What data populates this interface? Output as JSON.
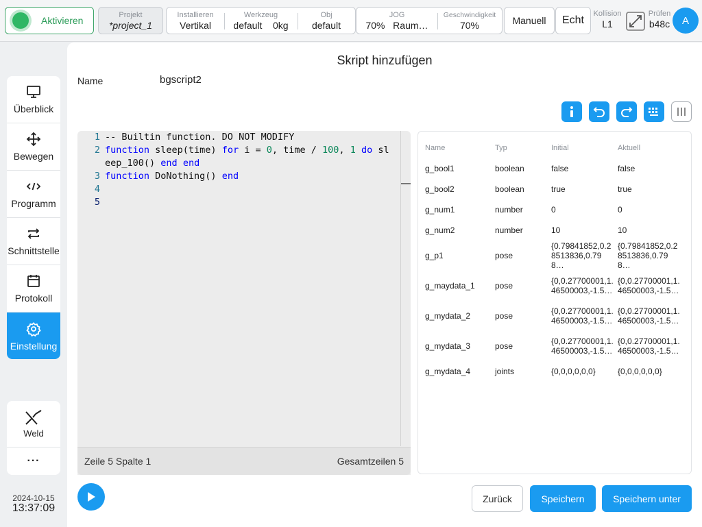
{
  "topbar": {
    "activate_label": "Aktivieren",
    "project_caption": "Projekt",
    "project_value": "*project_1",
    "install_caption": "Installieren",
    "install_value": "Vertikal",
    "tool_caption": "Werkzeug",
    "tool_value": "default",
    "tool_load": "0kg",
    "obj_caption": "Obj",
    "obj_value": "default",
    "jog_caption": "JOG",
    "jog_value": "70%",
    "jog_space": "Raum…",
    "speed_caption": "Geschwindigkeit",
    "speed_value": "70%",
    "manual_label": "Manuell",
    "real_label": "Echt",
    "collision_caption": "Kollision",
    "collision_value": "L1",
    "check_caption": "Prüfen",
    "check_value": "b48c",
    "avatar_letter": "A"
  },
  "sidebar": {
    "items": [
      {
        "label": "Überblick",
        "icon": "monitor-icon"
      },
      {
        "label": "Bewegen",
        "icon": "move-arrows-icon"
      },
      {
        "label": "Programm",
        "icon": "code-icon"
      },
      {
        "label": "Schnittstelle",
        "icon": "swap-icon"
      },
      {
        "label": "Protokoll",
        "icon": "calendar-icon"
      },
      {
        "label": "Einstellung",
        "icon": "gear-icon"
      }
    ],
    "active": "Einstellung",
    "weld_label": "Weld",
    "more_label": "···",
    "date": "2024-10-15",
    "time": "13:37:09"
  },
  "dialog": {
    "title": "Skript hinzufügen",
    "name_label": "Name",
    "name_value": "bgscript2"
  },
  "editor": {
    "lines": [
      {
        "num": "1",
        "text": "-- Builtin function. DO NOT MODIFY"
      },
      {
        "num": "2",
        "text": "function sleep(time) for i = 0, time / 100, 1 do sleep_100() end end"
      },
      {
        "num": "3",
        "text": "function DoNothing() end"
      },
      {
        "num": "4",
        "text": ""
      },
      {
        "num": "5",
        "text": ""
      }
    ],
    "cursor_status": "Zeile 5 Spalte 1",
    "total_lines": "Gesamtzeilen 5"
  },
  "variables": {
    "headers": [
      "Name",
      "Typ",
      "Initial",
      "Aktuell"
    ],
    "rows": [
      [
        "g_bool1",
        "boolean",
        "false",
        "false"
      ],
      [
        "g_bool2",
        "boolean",
        "true",
        "true"
      ],
      [
        "g_num1",
        "number",
        "0",
        "0"
      ],
      [
        "g_num2",
        "number",
        "10",
        "10"
      ],
      [
        "g_p1",
        "pose",
        "{0.79841852,0.28513836,0.798…",
        "{0.79841852,0.28513836,0.798…"
      ],
      [
        "g_maydata_1",
        "pose",
        "{0,0.27700001,1.46500003,-1.5…",
        "{0,0.27700001,1.46500003,-1.5…"
      ],
      [
        "g_mydata_2",
        "pose",
        "{0,0.27700001,1.46500003,-1.5…",
        "{0,0.27700001,1.46500003,-1.5…"
      ],
      [
        "g_mydata_3",
        "pose",
        "{0,0.27700001,1.46500003,-1.5…",
        "{0,0.27700001,1.46500003,-1.5…"
      ],
      [
        "g_mydata_4",
        "joints",
        "{0,0,0,0,0,0}",
        "{0,0,0,0,0,0}"
      ]
    ]
  },
  "buttons": {
    "back": "Zurück",
    "save": "Speichern",
    "save_as": "Speichern unter"
  },
  "colors": {
    "accent": "#1a9bf0",
    "active_green": "#2fb765"
  }
}
